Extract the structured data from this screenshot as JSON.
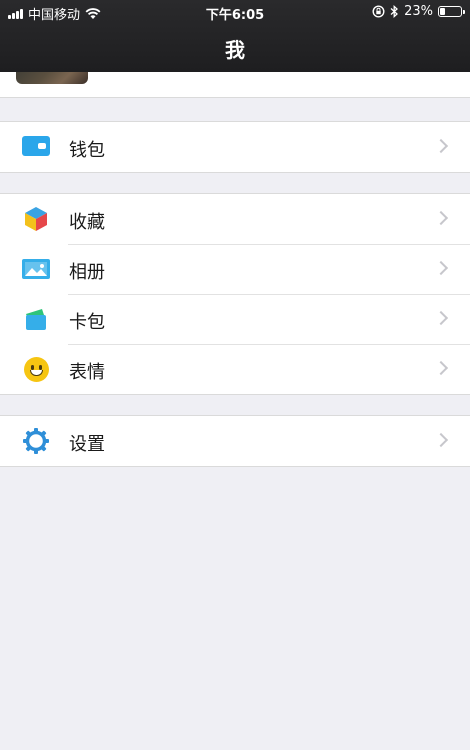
{
  "status_bar": {
    "carrier": "中国移动",
    "time": "下午6:05",
    "battery_text": "23%",
    "battery_level": 0.23
  },
  "nav": {
    "title": "我"
  },
  "menu": {
    "wallet": {
      "label": "钱包",
      "icon": "wallet-icon",
      "color": "#2aa6ea"
    },
    "favorites": {
      "label": "收藏",
      "icon": "favorites-cube-icon"
    },
    "album": {
      "label": "相册",
      "icon": "album-icon",
      "color": "#35aee9"
    },
    "cards": {
      "label": "卡包",
      "icon": "card-pack-icon"
    },
    "stickers": {
      "label": "表情",
      "icon": "emoji-icon",
      "color": "#f6c512"
    },
    "settings": {
      "label": "设置",
      "icon": "gear-icon",
      "color": "#2f8fd8"
    }
  },
  "colors": {
    "background": "#efeff4",
    "topbar": "#232325",
    "chevron": "#c7c7cc"
  }
}
